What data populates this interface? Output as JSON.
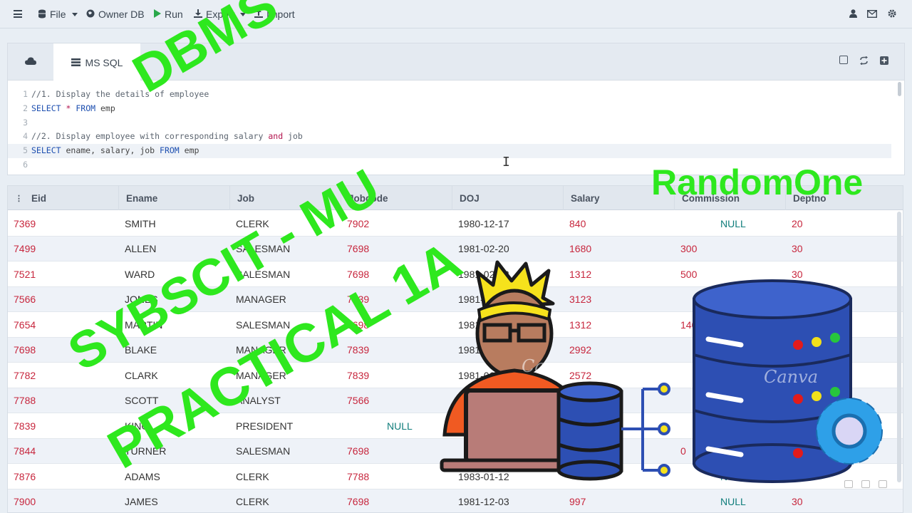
{
  "toolbar": {
    "file_label": "File",
    "owner_db_label": "Owner DB",
    "run_label": "Run",
    "export_label": "Export",
    "import_label": "Import"
  },
  "editor": {
    "tab_label": "MS SQL",
    "lines": [
      {
        "n": "1",
        "text": "//1. Display the details of employee"
      },
      {
        "n": "2",
        "text": "SELECT * FROM emp"
      },
      {
        "n": "3",
        "text": ""
      },
      {
        "n": "4",
        "text": "//2. Display employee with corresponding salary and job"
      },
      {
        "n": "5",
        "text": "SELECT ename, salary, job FROM emp"
      },
      {
        "n": "6",
        "text": ""
      }
    ]
  },
  "grid": {
    "columns": [
      "Eid",
      "Ename",
      "Job",
      "Jobcode",
      "DOJ",
      "Salary",
      "Commission",
      "Deptno"
    ],
    "rows": [
      [
        "7369",
        "SMITH",
        "CLERK",
        "7902",
        "1980-12-17",
        "840",
        "NULL",
        "20"
      ],
      [
        "7499",
        "ALLEN",
        "SALESMAN",
        "7698",
        "1981-02-20",
        "1680",
        "300",
        "30"
      ],
      [
        "7521",
        "WARD",
        "SALESMAN",
        "7698",
        "1981-02-22",
        "1312",
        "500",
        "30"
      ],
      [
        "7566",
        "JONES",
        "MANAGER",
        "7839",
        "1981-04-02",
        "3123",
        "",
        ""
      ],
      [
        "7654",
        "MARTIN",
        "SALESMAN",
        "7698",
        "1981-09-28",
        "1312",
        "1400",
        ""
      ],
      [
        "7698",
        "BLAKE",
        "MANAGER",
        "7839",
        "1981-05-01",
        "2992",
        "",
        ""
      ],
      [
        "7782",
        "CLARK",
        "MANAGER",
        "7839",
        "1981-06-09",
        "2572",
        "",
        ""
      ],
      [
        "7788",
        "SCOTT",
        "ANALYST",
        "7566",
        "",
        "",
        "",
        ""
      ],
      [
        "7839",
        "KING",
        "PRESIDENT",
        "NULL",
        "",
        "",
        "",
        ""
      ],
      [
        "7844",
        "TURNER",
        "SALESMAN",
        "7698",
        "",
        "",
        "0",
        ""
      ],
      [
        "7876",
        "ADAMS",
        "CLERK",
        "7788",
        "1983-01-12",
        "",
        "NULL",
        ""
      ],
      [
        "7900",
        "JAMES",
        "CLERK",
        "7698",
        "1981-12-03",
        "997",
        "NULL",
        "30"
      ]
    ]
  },
  "overlay": {
    "line1": "DBMS",
    "line2": "SYBSCIT - MU",
    "line3": "PRACTICAL 1A",
    "brand": "RandomOne",
    "watermark": "Canva"
  },
  "colors": {
    "overlay_green": "#2ee81e",
    "number_red": "#c7263d",
    "null_teal": "#0f7d7b",
    "db_blue": "#2d4fb3"
  },
  "icons": [
    "menu-icon",
    "database-icon",
    "globe-icon",
    "play-icon",
    "download-icon",
    "upload-icon",
    "user-icon",
    "mail-icon",
    "gear-icon",
    "cloud-icon",
    "table-icon",
    "save-icon",
    "refresh-icon",
    "plus-square-icon"
  ]
}
